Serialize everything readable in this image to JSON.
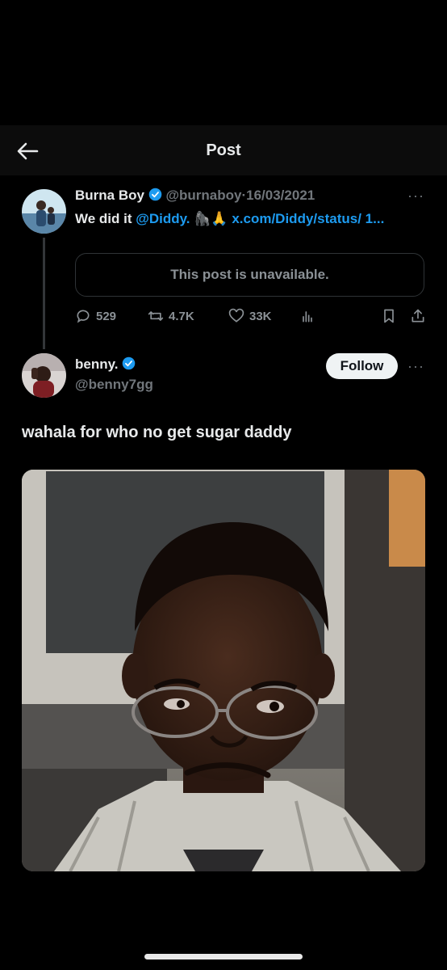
{
  "header": {
    "title": "Post",
    "back_icon": "arrow-left-icon"
  },
  "quoted_post": {
    "author_name": "Burna Boy",
    "handle": "@burnaboy",
    "date": "16/03/2021",
    "separator": "·",
    "text_prefix": "We did it ",
    "mention": "@Diddy.",
    "emojis": "🦍🙏",
    "link": "x.com/Diddy/status/",
    "link_cont": "1...",
    "unavailable_text": "This post is unavailable.",
    "stats": {
      "replies": "529",
      "reposts": "4.7K",
      "likes": "33K"
    }
  },
  "reply_post": {
    "author_name": "benny.",
    "handle": "@benny7gg",
    "follow_label": "Follow",
    "text": "wahala for who no get sugar daddy"
  },
  "colors": {
    "accent": "#1d9bf0",
    "background": "#000000",
    "muted": "#71767b"
  }
}
